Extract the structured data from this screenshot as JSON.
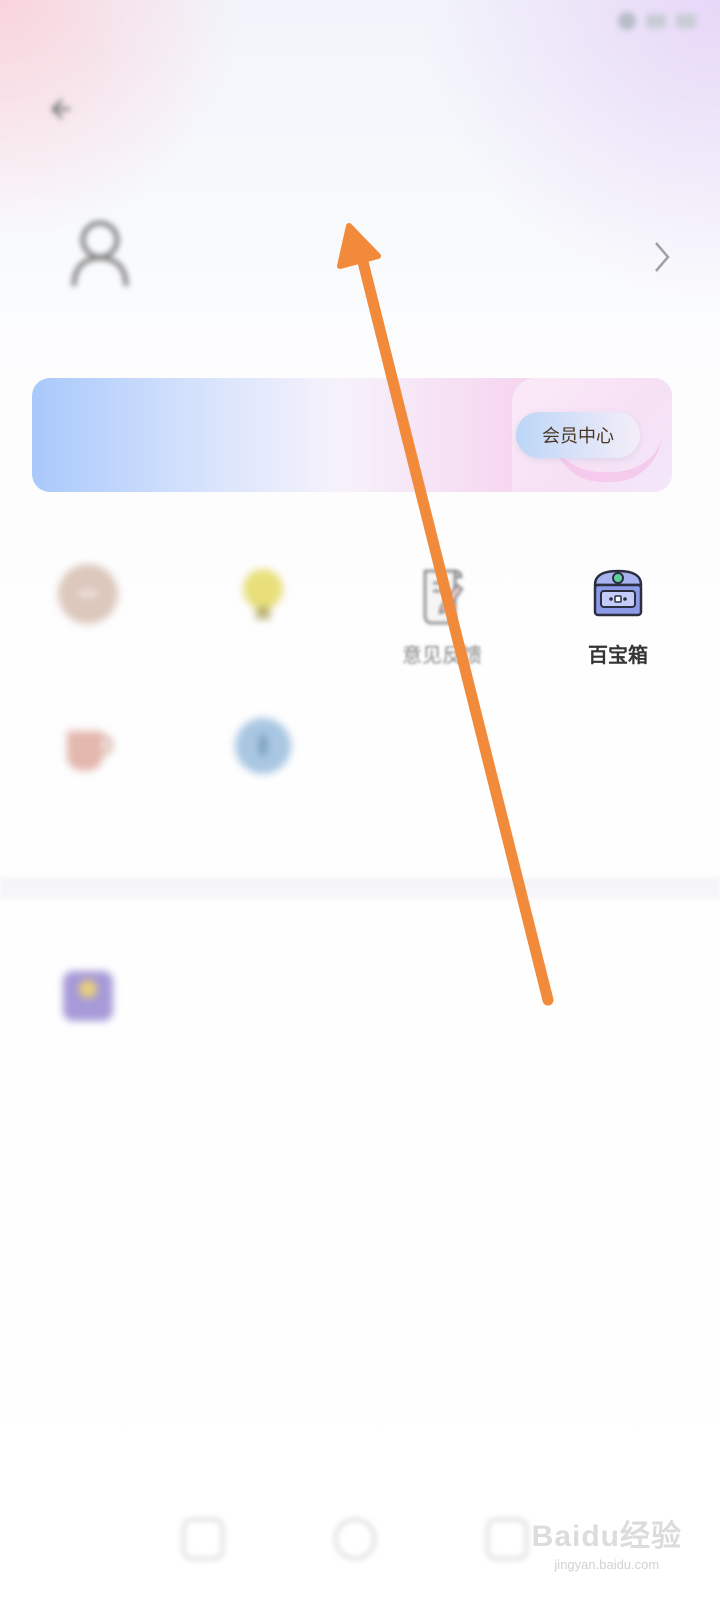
{
  "colors": {
    "arrow": "#f28a3c",
    "vip_button_text": "#4a3524",
    "accent_blue": "#a9c9fb",
    "accent_pink": "#f6d7f0"
  },
  "status_bar": {
    "time": ""
  },
  "header": {
    "back_icon": "back-icon"
  },
  "profile": {
    "username": "",
    "subtitle": "",
    "avatar_icon": "avatar-silhouette-icon",
    "chevron_icon": "chevron-right-icon"
  },
  "vip_banner": {
    "title": "",
    "description": "",
    "button_label": "会员中心"
  },
  "tools": {
    "items": [
      {
        "label": "",
        "icon": "circle-icon",
        "state": "blurred"
      },
      {
        "label": "",
        "icon": "lightbulb-icon",
        "state": "blurred"
      },
      {
        "label": "意见反馈",
        "icon": "feedback-scroll-icon",
        "state": "faded"
      },
      {
        "label": "百宝箱",
        "icon": "treasure-chest-icon",
        "state": "sharp"
      },
      {
        "label": "",
        "icon": "cup-icon",
        "state": "blurred"
      },
      {
        "label": "",
        "icon": "blue-circle-icon",
        "state": "blurred"
      },
      {
        "label": "",
        "icon": "purple-square-icon",
        "state": "blurred"
      }
    ]
  },
  "annotation": {
    "type": "arrow",
    "color": "#f28a3c"
  },
  "watermark": {
    "brand": "Baidu经验",
    "url": "jingyan.baidu.com"
  }
}
